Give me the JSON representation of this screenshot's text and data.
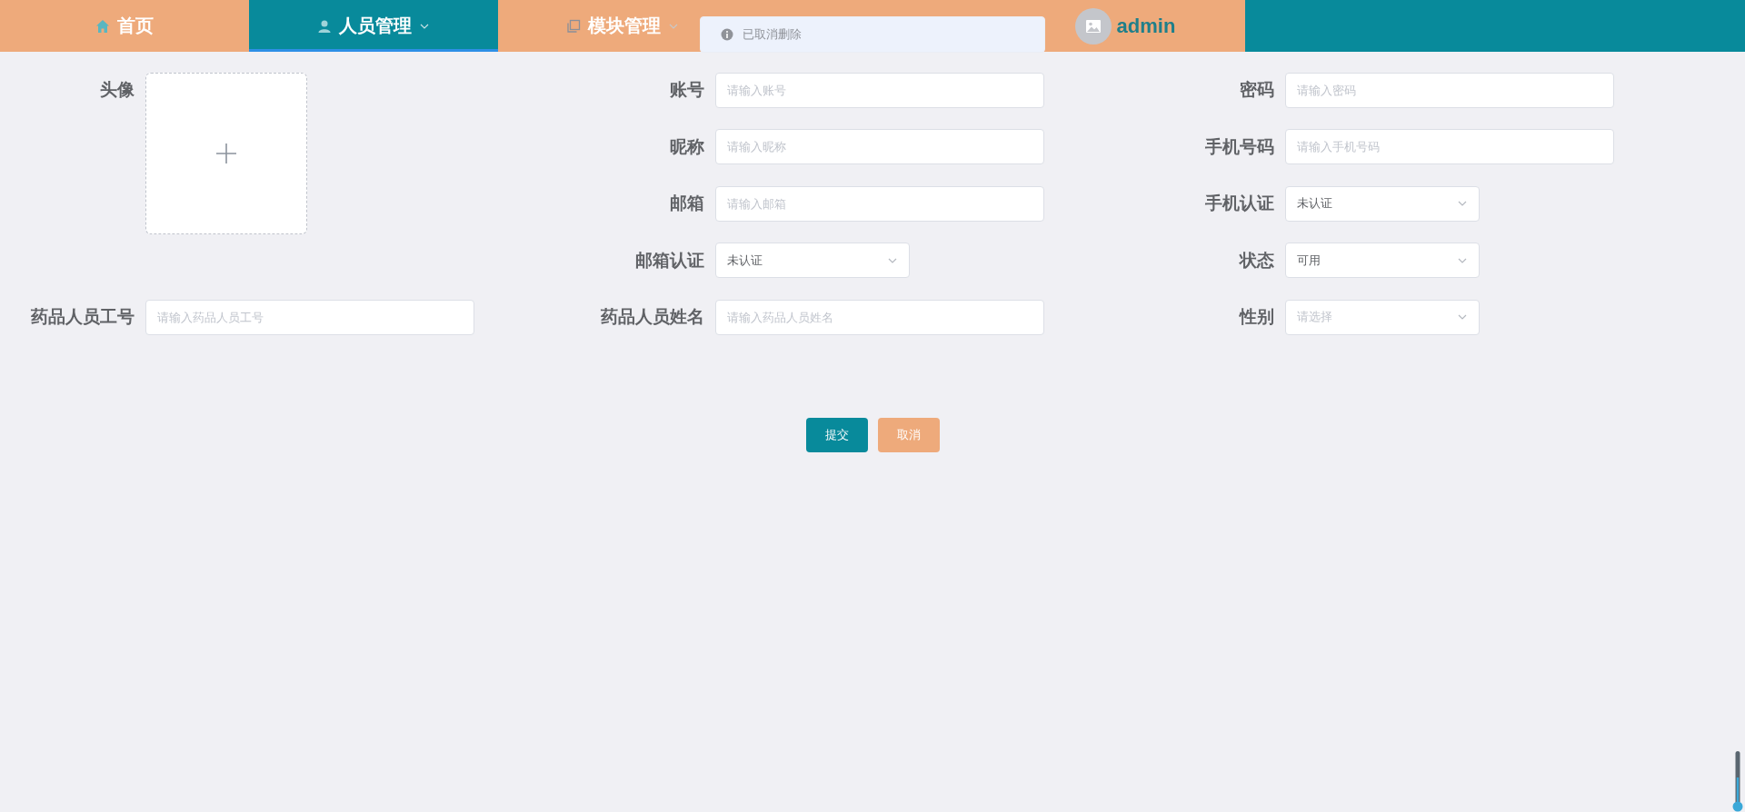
{
  "nav": {
    "items": [
      {
        "label": "首页",
        "kind": "home",
        "selected": false,
        "has_dropdown": false
      },
      {
        "label": "人员管理",
        "kind": "person",
        "selected": true,
        "has_dropdown": true
      },
      {
        "label": "模块管理",
        "kind": "modules",
        "selected": false,
        "has_dropdown": true
      }
    ],
    "user": {
      "name": "admin"
    }
  },
  "toast": {
    "kind": "info",
    "message": "已取消删除"
  },
  "form": {
    "columns": [
      [
        {
          "kind": "upload",
          "label": "头像"
        },
        {
          "kind": "input",
          "label": "药品人员工号",
          "placeholder": "请输入药品人员工号"
        }
      ],
      [
        {
          "kind": "input",
          "label": "账号",
          "placeholder": "请输入账号"
        },
        {
          "kind": "input",
          "label": "昵称",
          "placeholder": "请输入昵称"
        },
        {
          "kind": "input",
          "label": "邮箱",
          "placeholder": "请输入邮箱"
        },
        {
          "kind": "select",
          "label": "邮箱认证",
          "value": "未认证"
        },
        {
          "kind": "input",
          "label": "药品人员姓名",
          "placeholder": "请输入药品人员姓名"
        }
      ],
      [
        {
          "kind": "input",
          "label": "密码",
          "placeholder": "请输入密码"
        },
        {
          "kind": "input",
          "label": "手机号码",
          "placeholder": "请输入手机号码"
        },
        {
          "kind": "select",
          "label": "手机认证",
          "value": "未认证"
        },
        {
          "kind": "select",
          "label": "状态",
          "value": "可用"
        },
        {
          "kind": "select",
          "label": "性别",
          "placeholder": "请选择"
        }
      ]
    ],
    "buttons": [
      {
        "kind": "primary",
        "label": "提交"
      },
      {
        "kind": "secondary",
        "label": "取消"
      }
    ]
  },
  "widget": {
    "kind": "thermometer"
  }
}
